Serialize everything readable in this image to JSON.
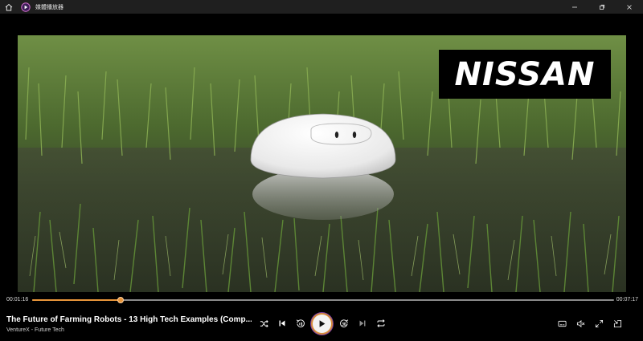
{
  "window": {
    "title": "媒體播放器",
    "icons": {
      "home": "home-icon",
      "app": "media-player-app-icon",
      "minimize": "minimize-icon",
      "maximize": "maximize-icon",
      "close": "close-icon"
    }
  },
  "video": {
    "overlay_logo": "NISSAN"
  },
  "playback": {
    "current_time": "00:01:16",
    "total_time": "00:07:17",
    "progress_fraction": 0.152
  },
  "media": {
    "title": "The Future of Farming Robots - 13 High Tech Examples (Comp...",
    "subtitle": "VentureX - Future Tech"
  },
  "controls": {
    "icons": [
      "shuffle-icon",
      "previous-icon",
      "rewind-10-icon",
      "play-icon",
      "forward-30-icon",
      "next-icon",
      "repeat-icon",
      "captions-icon",
      "volume-mute-icon",
      "fullscreen-icon",
      "mini-player-icon"
    ]
  },
  "colors": {
    "accent": "#e8953a",
    "titlebar": "#1f1f1f",
    "background": "#000000"
  }
}
